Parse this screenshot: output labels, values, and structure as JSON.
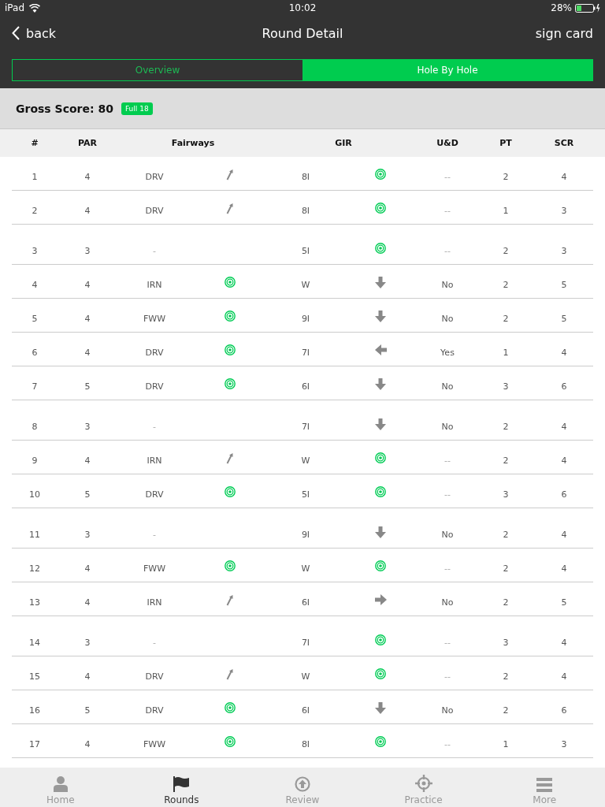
{
  "status_bar": {
    "device": "iPad",
    "time": "10:02",
    "battery": "28%"
  },
  "nav": {
    "back": "back",
    "title": "Round Detail",
    "action": "sign card"
  },
  "tabs": [
    {
      "label": "Overview",
      "selected": false
    },
    {
      "label": "Hole By Hole",
      "selected": true
    }
  ],
  "summary": {
    "label": "Gross Score: 80",
    "badge": "Full 18"
  },
  "table": {
    "columns": [
      {
        "label": "#",
        "kind": "single"
      },
      {
        "label": "PAR",
        "kind": "single"
      },
      {
        "label": "Fairways",
        "kind": "pair"
      },
      {
        "label": "GIR",
        "kind": "pair"
      },
      {
        "label": "U&D",
        "kind": "single"
      },
      {
        "label": "PT",
        "kind": "single"
      },
      {
        "label": "SCR",
        "kind": "single"
      }
    ],
    "rows": [
      {
        "hole": "1",
        "par": "4",
        "fairway": {
          "club": "DRV",
          "kind": "arrow"
        },
        "gir": {
          "club": "8I",
          "kind": "hit"
        },
        "ud": "--",
        "pt": "2",
        "scr": "4"
      },
      {
        "hole": "2",
        "par": "4",
        "fairway": {
          "club": "DRV",
          "kind": "arrow"
        },
        "gir": {
          "club": "8I",
          "kind": "hit"
        },
        "ud": "--",
        "pt": "1",
        "scr": "3"
      },
      {
        "hole": "3",
        "par": "3",
        "fairway": {
          "club": "-",
          "kind": "none"
        },
        "gir": {
          "club": "5I",
          "kind": "hit"
        },
        "ud": "--",
        "pt": "2",
        "scr": "3"
      },
      {
        "hole": "4",
        "par": "4",
        "fairway": {
          "club": "IRN",
          "kind": "hit"
        },
        "gir": {
          "club": "W",
          "kind": "down"
        },
        "ud": "No",
        "pt": "2",
        "scr": "5"
      },
      {
        "hole": "5",
        "par": "4",
        "fairway": {
          "club": "FWW",
          "kind": "hit"
        },
        "gir": {
          "club": "9I",
          "kind": "down"
        },
        "ud": "No",
        "pt": "2",
        "scr": "5"
      },
      {
        "hole": "6",
        "par": "4",
        "fairway": {
          "club": "DRV",
          "kind": "hit"
        },
        "gir": {
          "club": "7I",
          "kind": "left"
        },
        "ud": "Yes",
        "pt": "1",
        "scr": "4"
      },
      {
        "hole": "7",
        "par": "5",
        "fairway": {
          "club": "DRV",
          "kind": "hit"
        },
        "gir": {
          "club": "6I",
          "kind": "down"
        },
        "ud": "No",
        "pt": "3",
        "scr": "6"
      },
      {
        "hole": "8",
        "par": "3",
        "fairway": {
          "club": "-",
          "kind": "none"
        },
        "gir": {
          "club": "7I",
          "kind": "down"
        },
        "ud": "No",
        "pt": "2",
        "scr": "4"
      },
      {
        "hole": "9",
        "par": "4",
        "fairway": {
          "club": "IRN",
          "kind": "arrow"
        },
        "gir": {
          "club": "W",
          "kind": "hit"
        },
        "ud": "--",
        "pt": "2",
        "scr": "4"
      },
      {
        "hole": "10",
        "par": "5",
        "fairway": {
          "club": "DRV",
          "kind": "hit"
        },
        "gir": {
          "club": "5I",
          "kind": "hit"
        },
        "ud": "--",
        "pt": "3",
        "scr": "6"
      },
      {
        "hole": "11",
        "par": "3",
        "fairway": {
          "club": "-",
          "kind": "none"
        },
        "gir": {
          "club": "9I",
          "kind": "down"
        },
        "ud": "No",
        "pt": "2",
        "scr": "4"
      },
      {
        "hole": "12",
        "par": "4",
        "fairway": {
          "club": "FWW",
          "kind": "hit"
        },
        "gir": {
          "club": "W",
          "kind": "hit"
        },
        "ud": "--",
        "pt": "2",
        "scr": "4"
      },
      {
        "hole": "13",
        "par": "4",
        "fairway": {
          "club": "IRN",
          "kind": "arrow"
        },
        "gir": {
          "club": "6I",
          "kind": "right"
        },
        "ud": "No",
        "pt": "2",
        "scr": "5"
      },
      {
        "hole": "14",
        "par": "3",
        "fairway": {
          "club": "-",
          "kind": "none"
        },
        "gir": {
          "club": "7I",
          "kind": "hit"
        },
        "ud": "--",
        "pt": "3",
        "scr": "4"
      },
      {
        "hole": "15",
        "par": "4",
        "fairway": {
          "club": "DRV",
          "kind": "arrow"
        },
        "gir": {
          "club": "W",
          "kind": "hit"
        },
        "ud": "--",
        "pt": "2",
        "scr": "4"
      },
      {
        "hole": "16",
        "par": "5",
        "fairway": {
          "club": "DRV",
          "kind": "hit"
        },
        "gir": {
          "club": "6I",
          "kind": "down"
        },
        "ud": "No",
        "pt": "2",
        "scr": "6"
      },
      {
        "hole": "17",
        "par": "4",
        "fairway": {
          "club": "FWW",
          "kind": "hit"
        },
        "gir": {
          "club": "8I",
          "kind": "hit"
        },
        "ud": "--",
        "pt": "1",
        "scr": "3"
      }
    ]
  },
  "tab_bar": [
    {
      "label": "Home",
      "selected": false
    },
    {
      "label": "Rounds",
      "selected": true
    },
    {
      "label": "Review",
      "selected": false
    },
    {
      "label": "Practice",
      "selected": false
    },
    {
      "label": "More",
      "selected": false
    }
  ]
}
